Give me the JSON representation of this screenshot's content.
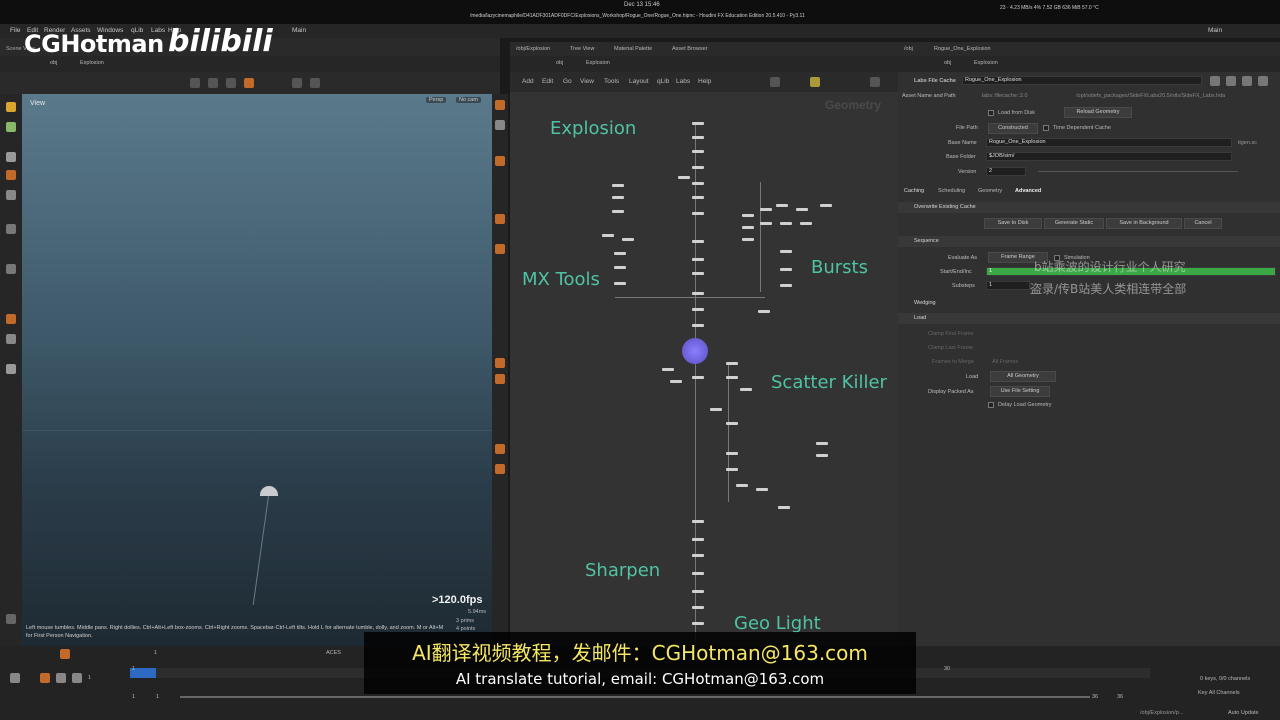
{
  "os": {
    "date": "Dec 13  15:46",
    "path": "/media/lazycinemaphile/D41ADF301ADF0DFC/Explosions_Workshop/Rogue_One/Rogue_One.hipnc - Houdini FX Education Edition 20.5.410 - Py3.11",
    "tray": "23 · 4.23 MB/s    4%   7.52 GB   636 MiB   57.0 °C"
  },
  "menu": [
    "File",
    "Edit",
    "Render",
    "Assets",
    "Windows",
    "qLib",
    "Labs",
    "Help"
  ],
  "desktop_left": "Main",
  "desktop_right": "Main",
  "viewport": {
    "tab": "Scene View",
    "path": "obj",
    "node": "Explosion",
    "view_label": "View",
    "persp": "Persp",
    "cam": "No cam",
    "fps": ">120.0fps",
    "ms": "5.94ms",
    "prims": "3  prims",
    "points": "4  points",
    "help": "Left mouse tumbles. Middle pans. Right dollies. Ctrl+Alt+Left box-zooms. Ctrl+Right zooms. Spacebar-Ctrl-Left tilts. Hold L for alternate tumble, dolly, and zoom.   M or Alt+M for First Person Navigation."
  },
  "network": {
    "tabs": [
      "/obj/Explosion",
      "Tree View",
      "Material Palette",
      "Asset Browser"
    ],
    "path": "obj",
    "node": "Explosion",
    "menu": [
      "Add",
      "Edit",
      "Go",
      "View",
      "Tools",
      "Layout",
      "qLib",
      "Labs",
      "Help"
    ],
    "watermark": "Geometry",
    "labels": {
      "explosion": "Explosion",
      "mx_tools": "MX Tools",
      "bursts": "Bursts",
      "scatter_killer": "Scatter Killer",
      "sharpen": "Sharpen",
      "geo_light": "Geo Light"
    }
  },
  "params": {
    "tabs": [
      "/obj",
      "Rogue_One_Explosion"
    ],
    "path": "obj",
    "node": "Explosion",
    "type_label": "Labs File Cache",
    "node_name": "Rogue_One_Explosion",
    "asset_label": "Asset Name and Path",
    "asset_name": "labs::filecache::2.0",
    "asset_path": "/opt/sidefx_packages/SideFXLabs20.5/otls/SideFX_Labs.hda",
    "load_from_disk": "Load from Disk",
    "reload_geometry": "Reload Geometry",
    "file_path_label": "File Path",
    "file_path_value": "Constructed",
    "time_dependent": "Time Dependent Cache",
    "base_name_label": "Base Name",
    "base_name_value": "Rogue_One_Explosion",
    "base_name_hint": "tigen.sc",
    "base_folder_label": "Base Folder",
    "base_folder_value": "$JOB/sim/",
    "version_label": "Version",
    "version_value": "2",
    "sub_tabs": [
      "Caching",
      "Scheduling",
      "Geometry",
      "Advanced"
    ],
    "override": "Overwrite Existing Cache",
    "buttons": [
      "Save to Disk",
      "Generate Static",
      "Save in Background",
      "Cancel"
    ],
    "sequence": "Sequence",
    "evaluate_label": "Evaluate As",
    "evaluate_value": "Frame Range",
    "simulation": "Simulation",
    "start_label": "Start/End/Inc",
    "start_value": "1",
    "substeps_label": "Substeps",
    "substeps_value": "1",
    "wedging": "Wedging",
    "load_section": "Load",
    "clamp_first": "Clamp First Frame",
    "clamp_last": "Clamp Last Frame",
    "frames_to_merge_label": "Frames to Merge",
    "frames_to_merge_value": "All Frames",
    "load_label": "Load",
    "load_value": "All Geometry",
    "display_packed_label": "Display Packed As",
    "display_packed_value": "Use File Setting",
    "delay_load": "Delay Load Geometry",
    "overlay_line1": "b站乘波的设计行业个人研究",
    "overlay_line2": "盗录/传B站美人类相连带全部"
  },
  "timeline": {
    "frame": "1",
    "start": "1",
    "end": "36",
    "end2": "36",
    "colorspace": "ACES",
    "ticks": [
      "1",
      "30"
    ],
    "keys": "0 keys, 0/0 channels",
    "key_all": "Key All Channels",
    "auto_update": "Auto Update",
    "status_path": "/obj/Explosion/p..."
  },
  "overlay": {
    "channel": "CGHotman",
    "logo": "bilibili",
    "subtitle_zh": "AI翻译视频教程，发邮件：CGHotman@163.com",
    "subtitle_en": "AI translate tutorial, email: CGHotman@163.com"
  },
  "colors": {
    "label_green": "#4fc3a4",
    "range_green": "#3aa845",
    "subtitle_yellow": "#f5e663"
  }
}
